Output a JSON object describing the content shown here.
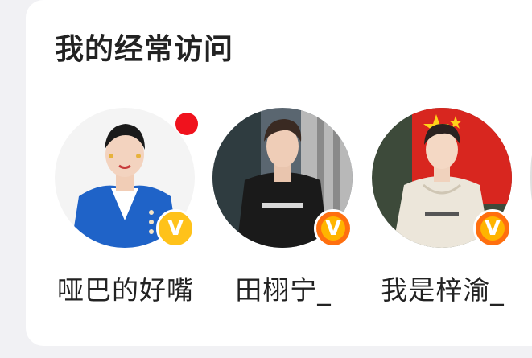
{
  "section": {
    "title": "我的经常访问"
  },
  "users": [
    {
      "name": "哑巴的好嘴",
      "badge": "V",
      "badge_color": "#ffc21a",
      "has_unread": true
    },
    {
      "name": "田栩宁_",
      "badge": "V",
      "badge_color": "#ff6f0f",
      "has_unread": false
    },
    {
      "name": "我是梓渝_",
      "badge": "V",
      "badge_color": "#ff6f0f",
      "has_unread": false
    }
  ],
  "colors": {
    "unread_dot": "#f0121d",
    "card_bg": "#ffffff",
    "page_bg": "#f1f1f4"
  }
}
